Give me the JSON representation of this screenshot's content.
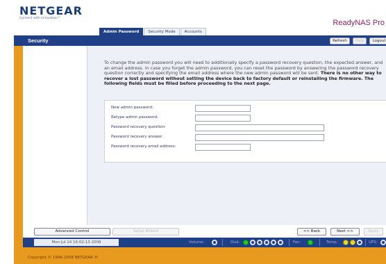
{
  "brand": {
    "logo": "NETGEAR",
    "tagline": "Connect with Innovation™",
    "product": "ReadyNAS Pro"
  },
  "tabs": [
    {
      "label": "Admin Password",
      "active": true
    },
    {
      "label": "Security Mode",
      "active": false
    },
    {
      "label": "Accounts",
      "active": false
    }
  ],
  "nav": {
    "section": "Security",
    "refresh": "Refresh",
    "help": "Help",
    "logout": "Logout"
  },
  "content": {
    "intro": "To change the admin password you will need to additionally specify a password recovery question, the expected answer, and an email address. In case you forget the admin password, you can reset the password by answering the password recovery question correctly and specifying the email address where the new admin password will be sent.",
    "warning": "There is no other way to recover a lost password without setting the device back to factory default or reinstalling the firmware. The following fields must be filled before proceeding to the next page."
  },
  "form": {
    "new_password": {
      "label": "New admin password:",
      "value": ""
    },
    "retype_password": {
      "label": "Retype admin password:",
      "value": ""
    },
    "recovery_question": {
      "label": "Password recovery question:",
      "value": ""
    },
    "recovery_answer": {
      "label": "Password recovery answer:",
      "value": ""
    },
    "recovery_email": {
      "label": "Password recovery email address:",
      "value": ""
    }
  },
  "bottom": {
    "advanced_control": "Advanced Control",
    "setup_wizard": "Setup Wizard",
    "back": "<< Back",
    "next": "Next >>",
    "apply": "Apply"
  },
  "status": {
    "datetime": "Mon Jul 14  16:02:13 2008",
    "volume": "Volume:",
    "disk": "Disk:",
    "fan": "Fan:",
    "temp": "Temp:",
    "ups": "UPS:"
  },
  "copyright": "Copyright © 1996-2008 NETGEAR ®",
  "colors": {
    "brand_blue": "#1f3f87",
    "frame_orange": "#e89a1e",
    "product_purple": "#8a1f64",
    "status_green": "#20d020",
    "status_yellow": "#f0d820"
  }
}
